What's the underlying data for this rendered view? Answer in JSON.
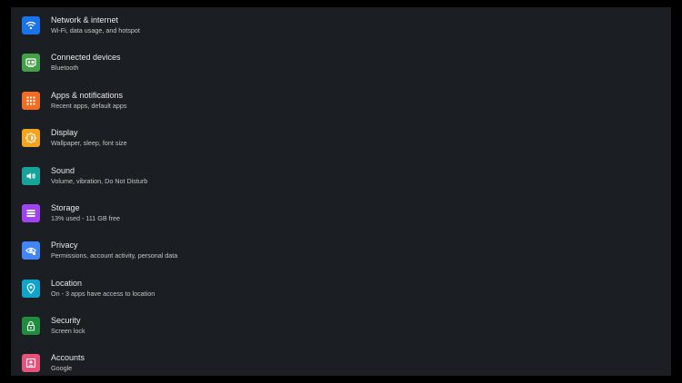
{
  "settings": {
    "items": [
      {
        "title": "Network & internet",
        "subtitle": "Wi-Fi, data usage, and hotspot",
        "icon": "wifi-icon",
        "color": "#1a73e8"
      },
      {
        "title": "Connected devices",
        "subtitle": "Bluetooth",
        "icon": "devices-icon",
        "color": "#43a047"
      },
      {
        "title": "Apps & notifications",
        "subtitle": "Recent apps, default apps",
        "icon": "apps-grid-icon",
        "color": "#f26d21"
      },
      {
        "title": "Display",
        "subtitle": "Wallpaper, sleep, font size",
        "icon": "brightness-icon",
        "color": "#f4a31d"
      },
      {
        "title": "Sound",
        "subtitle": "Volume, vibration, Do Not Disturb",
        "icon": "volume-icon",
        "color": "#16a39a"
      },
      {
        "title": "Storage",
        "subtitle": "13% used - 111 GB free",
        "icon": "storage-icon",
        "color": "#a142f4"
      },
      {
        "title": "Privacy",
        "subtitle": "Permissions, account activity, personal data",
        "icon": "privacy-eye-icon",
        "color": "#4285f4"
      },
      {
        "title": "Location",
        "subtitle": "On - 3 apps have access to location",
        "icon": "location-pin-icon",
        "color": "#12a4c8"
      },
      {
        "title": "Security",
        "subtitle": "Screen lock",
        "icon": "lock-icon",
        "color": "#1e8e3e"
      },
      {
        "title": "Accounts",
        "subtitle": "Google",
        "icon": "account-icon",
        "color": "#e8527a"
      }
    ]
  }
}
